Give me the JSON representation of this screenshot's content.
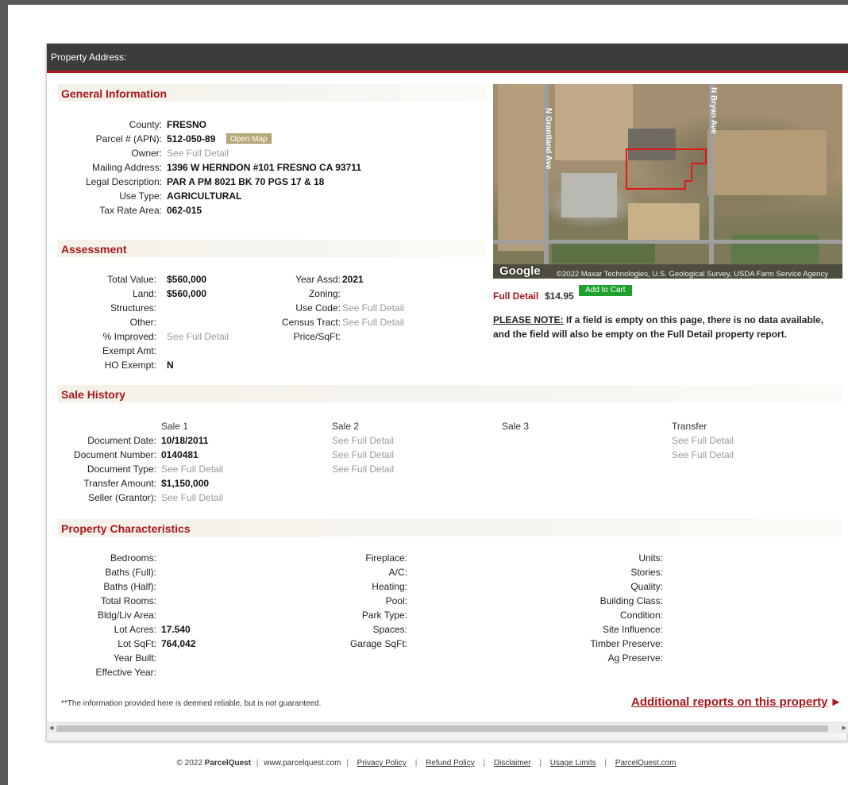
{
  "titlebar": {
    "label": "Property Address:"
  },
  "general": {
    "title": "General Information",
    "labels": {
      "county": "County:",
      "parcel": "Parcel # (APN):",
      "owner": "Owner:",
      "mailing": "Mailing Address:",
      "legal": "Legal Description:",
      "use": "Use Type:",
      "tax": "Tax Rate Area:"
    },
    "values": {
      "county": "FRESNO",
      "parcel": "512-050-89",
      "open_map": "Open Map",
      "owner": "See Full Detail",
      "mailing": "1396 W HERNDON #101 FRESNO CA 93711",
      "legal": "PAR A PM 8021 BK 70 PGS 17 & 18",
      "use": "AGRICULTURAL",
      "tax": "062-015"
    }
  },
  "map": {
    "road_left": "N Grantland Ave",
    "road_right": "N Bryan Ave",
    "google": "Google",
    "credit": "©2022 Maxar Technologies, U.S. Geological Survey, USDA Farm Service Agency",
    "parcel_color": "#e01a1a"
  },
  "purchase": {
    "label": "Full Detail",
    "price": "$14.95",
    "add_to_cart": "Add to Cart"
  },
  "note": {
    "heading": "PLEASE NOTE:",
    "line1": " If a field is empty on this page, there is no data available,",
    "line2": "and the field will also be empty on the Full Detail property report."
  },
  "assessment": {
    "title": "Assessment",
    "left_labels": {
      "total": "Total Value:",
      "land": "Land:",
      "structures": "Structures:",
      "other": "Other:",
      "improved": "% Improved:",
      "exempt": "Exempt Amt:",
      "ho": "HO Exempt:"
    },
    "left_values": {
      "total": "$560,000",
      "land": "$560,000",
      "improved": "See Full Detail",
      "ho": "N"
    },
    "right_labels": {
      "year": "Year Assd:",
      "zoning": "Zoning:",
      "usecode": "Use Code:",
      "census": "Census Tract:",
      "price": "Price/SqFt:"
    },
    "right_values": {
      "year": "2021",
      "usecode": "See Full Detail",
      "census": "See Full Detail"
    }
  },
  "sales": {
    "title": "Sale History",
    "columns": [
      "Sale 1",
      "Sale 2",
      "Sale 3",
      "Transfer"
    ],
    "labels": {
      "date": "Document Date:",
      "number": "Document Number:",
      "type": "Document Type:",
      "amount": "Transfer Amount:",
      "seller": "Seller (Grantor):"
    },
    "sale1": {
      "date": "10/18/2011",
      "number": "0140481",
      "type": "See Full Detail",
      "amount": "$1,150,000",
      "seller": "See Full Detail"
    },
    "sale2": {
      "date": "See Full Detail",
      "number": "See Full Detail",
      "type": "See Full Detail"
    },
    "transfer": {
      "date": "See Full Detail",
      "number": "See Full Detail"
    }
  },
  "characteristics": {
    "title": "Property Characteristics",
    "col1_labels": [
      "Bedrooms:",
      "Baths (Full):",
      "Baths (Half):",
      "Total Rooms:",
      "Bldg/Liv Area:",
      "Lot Acres:",
      "Lot SqFt:",
      "Year Built:",
      "Effective Year:"
    ],
    "col1_values": {
      "lot_acres": "17.540",
      "lot_sqft": "764,042"
    },
    "col2_labels": [
      "Fireplace:",
      "A/C:",
      "Heating:",
      "Pool:",
      "Park Type:",
      "Spaces:",
      "Garage SqFt:"
    ],
    "col3_labels": [
      "Units:",
      "Stories:",
      "Quality:",
      "Building Class:",
      "Condition:",
      "Site Influence:",
      "Timber Preserve:",
      "Ag Preserve:"
    ]
  },
  "footnote": "**The information provided here is deemed reliable, but is not guaranteed.",
  "reports_link": "Additional reports on this property",
  "footer": {
    "copyright": "© 2022 ",
    "brand": "ParcelQuest",
    "site": "www.parcelquest.com",
    "links": [
      "Privacy Policy",
      "Refund Policy",
      "Disclaimer",
      "Usage Limits",
      "ParcelQuest.com"
    ]
  }
}
